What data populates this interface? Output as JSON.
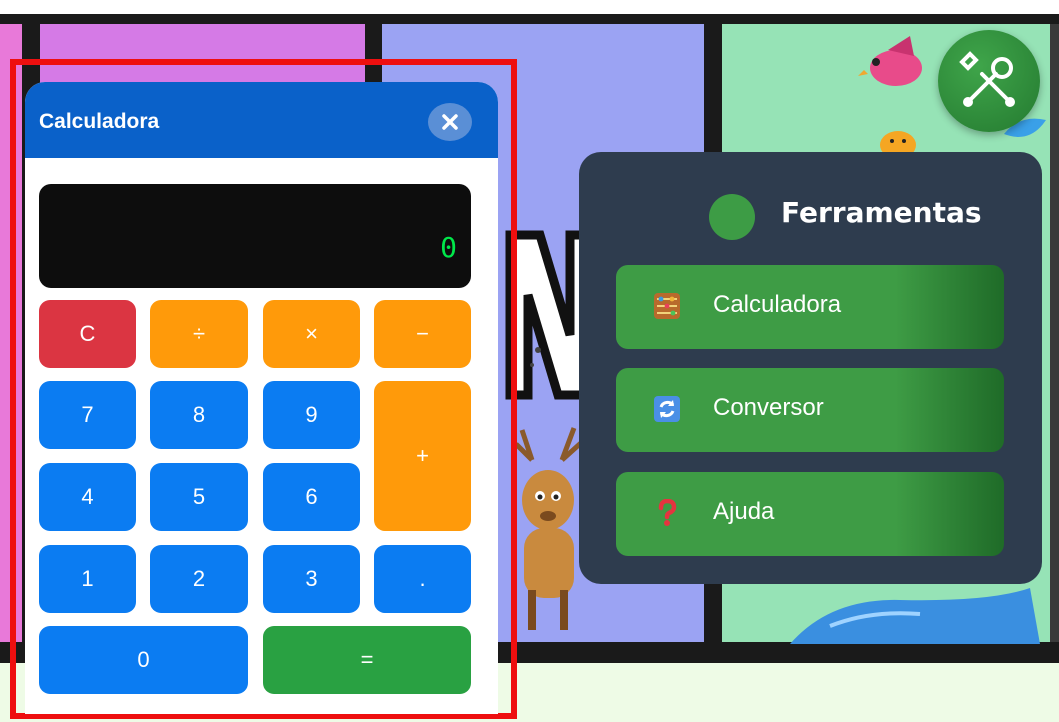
{
  "calculator": {
    "title": "Calculadora",
    "display_value": "0",
    "keys": {
      "clear": "C",
      "divide": "÷",
      "multiply": "×",
      "minus": "−",
      "seven": "7",
      "eight": "8",
      "nine": "9",
      "plus": "+",
      "four": "4",
      "five": "5",
      "six": "6",
      "one": "1",
      "two": "2",
      "three": "3",
      "dot": ".",
      "zero": "0",
      "equals": "="
    }
  },
  "tools_menu": {
    "title": "Ferramentas",
    "items": [
      {
        "label": "Calculadora",
        "icon": "abacus-icon"
      },
      {
        "label": "Conversor",
        "icon": "refresh-icon"
      },
      {
        "label": "Ajuda",
        "icon": "question-icon"
      }
    ]
  },
  "colors": {
    "header_blue": "#0a61c9",
    "key_blue": "#0b7cf2",
    "key_orange": "#ff9a0a",
    "key_red": "#db3542",
    "key_green": "#29a142",
    "display_text": "#00e84a",
    "menu_bg": "#2e3c4e",
    "menu_item_green": "#3e9c45",
    "highlight_frame": "#ee0f0f"
  }
}
